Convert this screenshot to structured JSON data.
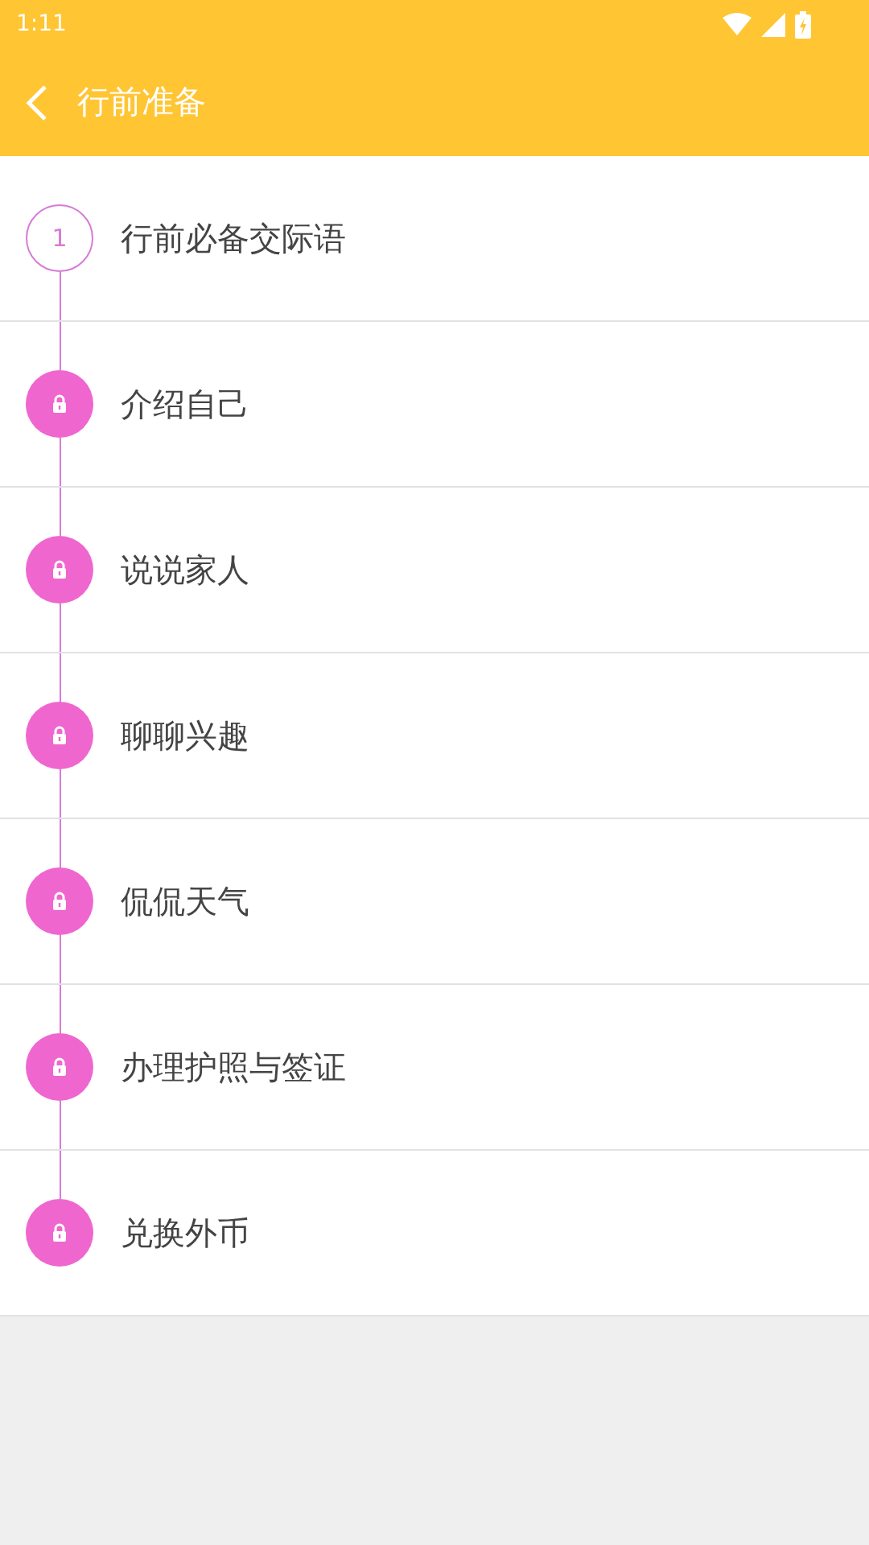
{
  "status_bar": {
    "time": "1:11"
  },
  "header": {
    "title": "行前准备"
  },
  "lessons": [
    {
      "title": "行前必备交际语",
      "locked": false,
      "number": "1"
    },
    {
      "title": "介绍自己",
      "locked": true
    },
    {
      "title": "说说家人",
      "locked": true
    },
    {
      "title": "聊聊兴趣",
      "locked": true
    },
    {
      "title": "侃侃天气",
      "locked": true
    },
    {
      "title": "办理护照与签证",
      "locked": true
    },
    {
      "title": "兑换外币",
      "locked": true
    }
  ]
}
